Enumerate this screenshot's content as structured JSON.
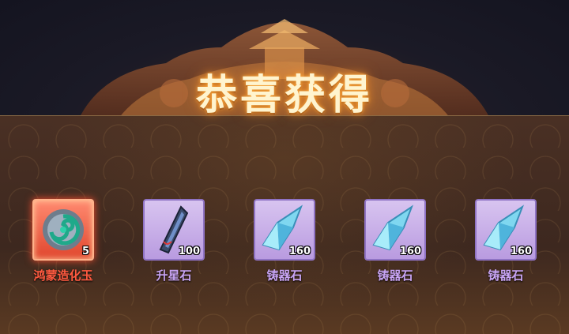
{
  "title": "恭喜获得",
  "items": [
    {
      "name": "鸿蒙造化玉",
      "count": "5",
      "rarity": "red",
      "icon": "jade-orb-icon"
    },
    {
      "name": "升星石",
      "count": "100",
      "rarity": "purple",
      "icon": "star-stone-icon"
    },
    {
      "name": "铸器石",
      "count": "160",
      "rarity": "purple",
      "icon": "crystal-icon"
    },
    {
      "name": "铸器石",
      "count": "160",
      "rarity": "purple",
      "icon": "crystal-icon"
    },
    {
      "name": "铸器石",
      "count": "160",
      "rarity": "purple",
      "icon": "crystal-icon"
    }
  ],
  "colors": {
    "rarity_red": "#ff5a40",
    "rarity_purple": "#c8a4f4",
    "title_glow": "#e07a1c"
  }
}
